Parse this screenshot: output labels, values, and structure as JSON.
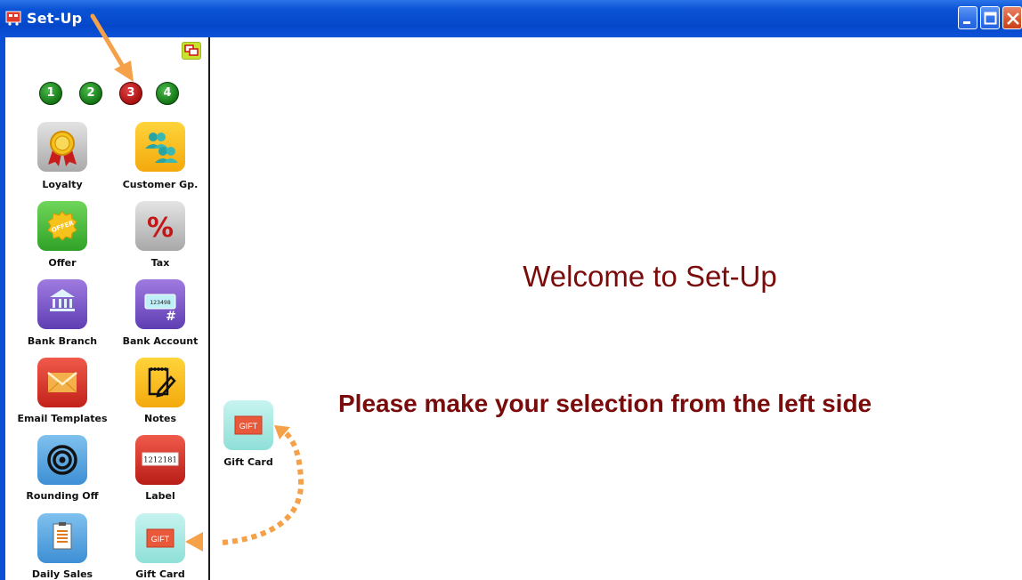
{
  "window": {
    "title": "Set-Up",
    "controls": [
      "minimize-icon",
      "maximize-icon",
      "close-icon"
    ]
  },
  "steps": [
    {
      "label": "1",
      "state": "complete",
      "color": "#1a8a1a"
    },
    {
      "label": "2",
      "state": "complete",
      "color": "#1a8a1a"
    },
    {
      "label": "3",
      "state": "current",
      "color": "#b01212"
    },
    {
      "label": "4",
      "state": "complete",
      "color": "#1a8a1a"
    }
  ],
  "modules": [
    {
      "label": "Loyalty",
      "icon": "ribbon-award-icon"
    },
    {
      "label": "Customer Gp.",
      "icon": "people-group-icon"
    },
    {
      "label": "Offer",
      "icon": "offer-badge-icon"
    },
    {
      "label": "Tax",
      "icon": "percent-icon"
    },
    {
      "label": "Bank Branch",
      "icon": "bank-icon"
    },
    {
      "label": "Bank Account",
      "icon": "bank-card-icon"
    },
    {
      "label": "Email Templates",
      "icon": "envelope-icon"
    },
    {
      "label": "Notes",
      "icon": "notepad-icon"
    },
    {
      "label": "Rounding Off",
      "icon": "target-icon"
    },
    {
      "label": "Label",
      "icon": "barcode-label-icon"
    },
    {
      "label": "Daily Sales",
      "icon": "document-icon"
    },
    {
      "label": "Gift Card",
      "icon": "gift-card-icon"
    }
  ],
  "icon_texts": {
    "offer": "OFFER",
    "tax": "%",
    "bank_account_number": "123498",
    "bank_account_hash": "#",
    "label_number": "1212181",
    "gift": "GIFT"
  },
  "drag_preview": {
    "label": "Gift Card",
    "icon": "gift-card-icon",
    "icon_text": "GIFT"
  },
  "main": {
    "welcome": "Welcome to Set-Up",
    "instruction": "Please make your selection from the left side"
  },
  "colors": {
    "titlebar": "#0a53d6",
    "welcome_text": "#7a0b0b",
    "annotation_arrow": "#f5a14a",
    "step_active": "#b01212",
    "step_done": "#1a8a1a"
  }
}
